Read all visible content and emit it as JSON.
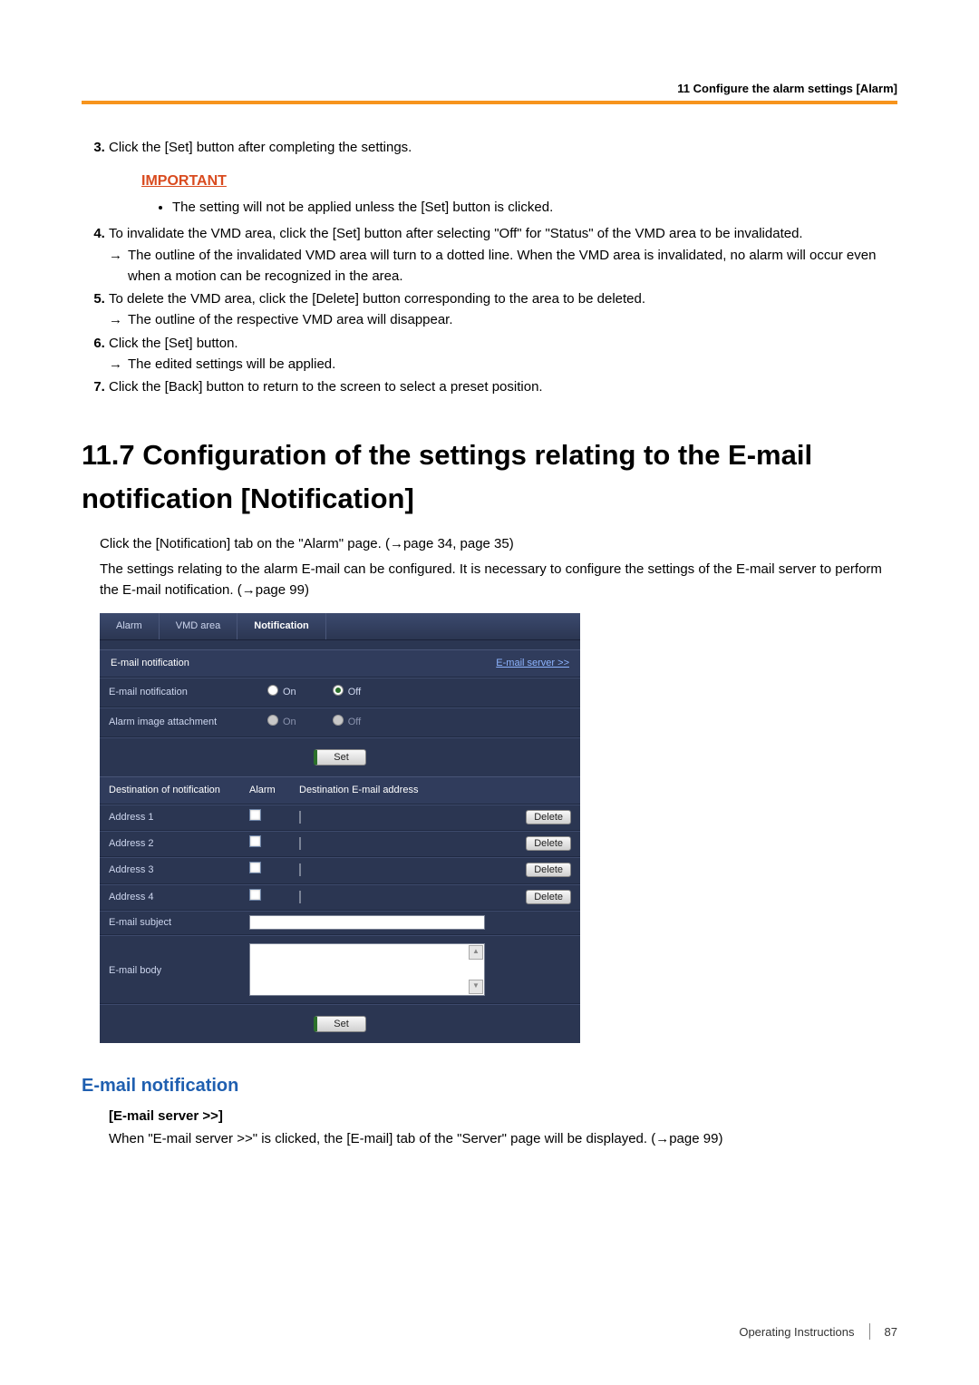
{
  "header": {
    "chapterLabel": "11 Configure the alarm settings [Alarm]"
  },
  "steps": {
    "s3": "Click the [Set] button after completing the settings.",
    "important": "IMPORTANT",
    "importantBullet": "The setting will not be applied unless the [Set] button is clicked.",
    "s4": "To invalidate the VMD area, click the [Set] button after selecting \"Off\" for \"Status\" of the VMD area to be invalidated.",
    "s4arrow": "The outline of the invalidated VMD area will turn to a dotted line. When the VMD area is invalidated, no alarm will occur even when a motion can be recognized in the area.",
    "s5": "To delete the VMD area, click the [Delete] button corresponding to the area to be deleted.",
    "s5arrow": "The outline of the respective VMD area will disappear.",
    "s6": "Click the [Set] button.",
    "s6arrow": "The edited settings will be applied.",
    "s7": "Click the [Back] button to return to the screen to select a preset position."
  },
  "section": {
    "title": "11.7  Configuration of the settings relating to the E-mail notification [Notification]",
    "p1a": "Click the [Notification] tab on the \"Alarm\" page. (",
    "p1b": "page 34, page 35)",
    "p2a": "The settings relating to the alarm E-mail can be configured. It is necessary to configure the settings of the E-mail server to perform the E-mail notification. (",
    "p2b": "page 99)"
  },
  "panel": {
    "tabs": {
      "alarm": "Alarm",
      "vmd": "VMD area",
      "notification": "Notification"
    },
    "emailNotifSection": "E-mail notification",
    "emailServerLink": "E-mail server >>",
    "rowEmailNotif": "E-mail notification",
    "rowAlarmImage": "Alarm image attachment",
    "on": "On",
    "off": "Off",
    "set": "Set",
    "destHeader": {
      "c1": "Destination of notification",
      "c2": "Alarm",
      "c3": "Destination E-mail address"
    },
    "addr": [
      "Address 1",
      "Address 2",
      "Address 3",
      "Address 4"
    ],
    "delete": "Delete",
    "subject": "E-mail subject",
    "body": "E-mail body"
  },
  "sub": {
    "heading": "E-mail notification",
    "serverTitle": "[E-mail server >>]",
    "serverDescA": "When \"E-mail server >>\" is clicked, the [E-mail] tab of the \"Server\" page will be displayed. (",
    "serverDescB": "page 99)"
  },
  "footer": {
    "doc": "Operating Instructions",
    "page": "87"
  },
  "sym": {
    "arrow": "→"
  }
}
